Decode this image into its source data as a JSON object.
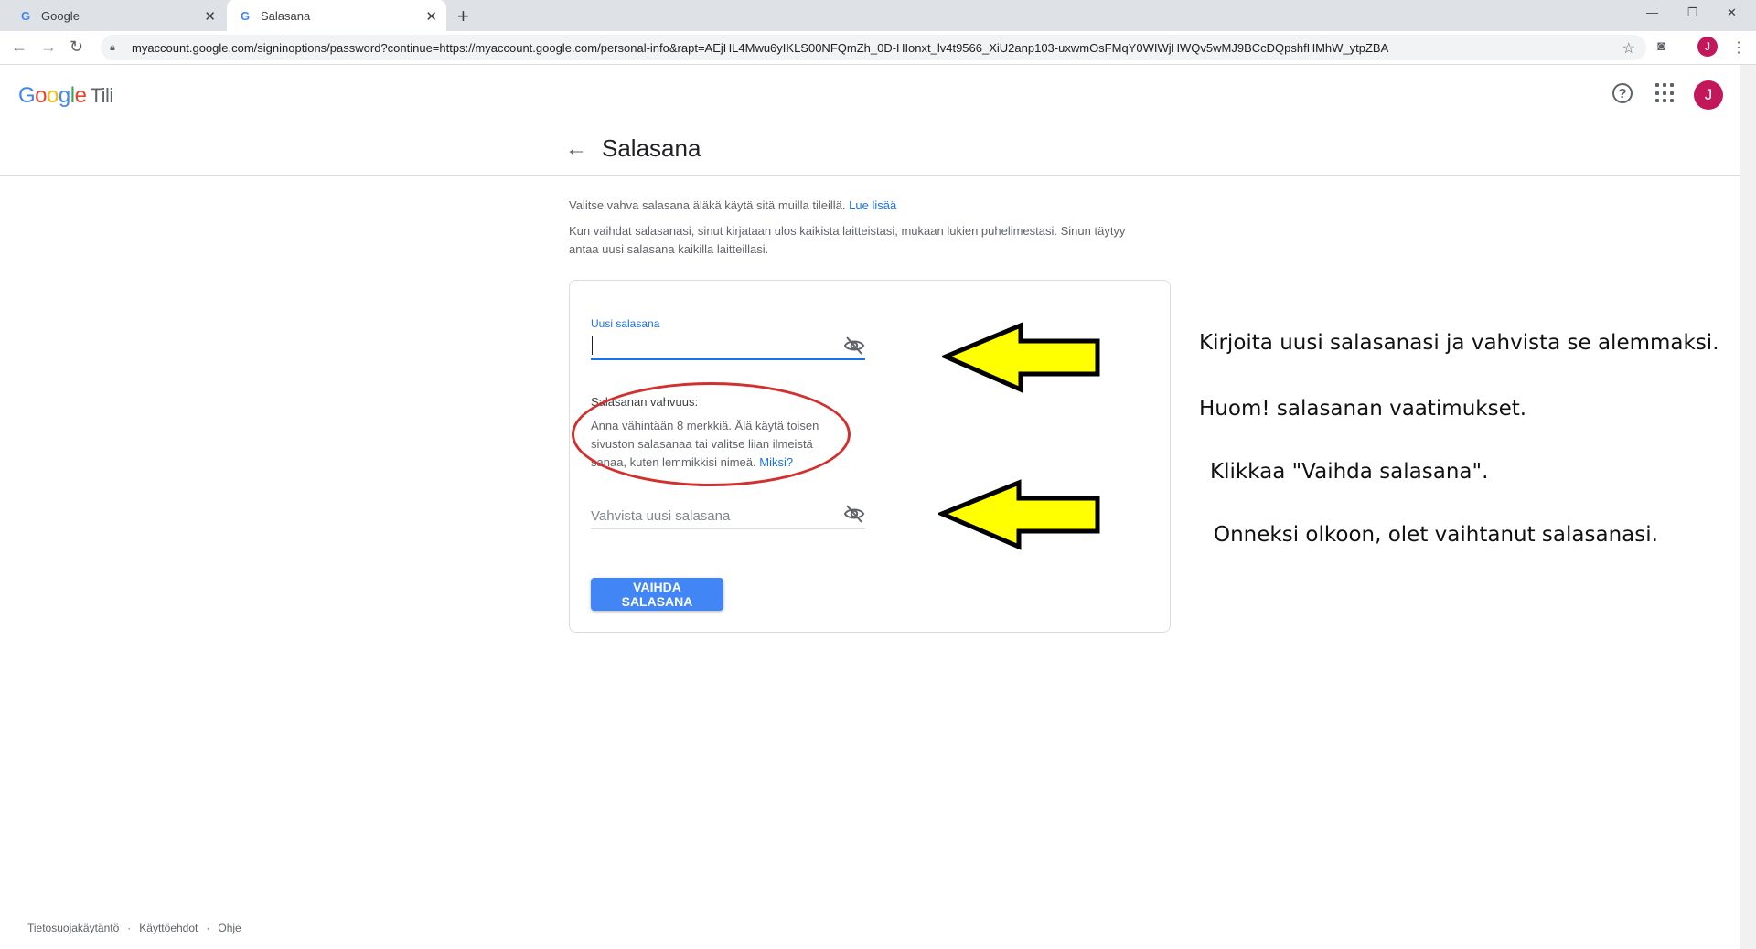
{
  "browser": {
    "tabs": [
      {
        "title": "Google",
        "active": false
      },
      {
        "title": "Salasana",
        "active": true
      }
    ],
    "url": "myaccount.google.com/signinoptions/password?continue=https://myaccount.google.com/personal-info&rapt=AEjHL4Mwu6yIKLS00NFQmZh_0D-HIonxt_lv4t9566_XiU2anp103-uxwmOsFMqY0WIWjHWQv5wMJ9BCcDQpshfHMhW_ytpZBA",
    "profile_initial": "J"
  },
  "header": {
    "logo_text": "Google",
    "product": "Tili",
    "avatar_initial": "J",
    "page_title": "Salasana"
  },
  "intro": {
    "line1": "Valitse vahva salasana äläkä käytä sitä muilla tileillä.",
    "line1_link": "Lue lisää",
    "line2": "Kun vaihdat salasanasi, sinut kirjataan ulos kaikista laitteistasi, mukaan lukien puhelimestasi. Sinun täytyy antaa uusi salasana kaikilla laitteillasi."
  },
  "form": {
    "new_password_label": "Uusi salasana",
    "new_password_value": "",
    "strength_title": "Salasanan vahvuus:",
    "strength_text": "Anna vähintään 8 merkkiä. Älä käytä toisen sivuston salasanaa tai valitse liian ilmeistä sanaa, kuten lemmikkisi nimeä.",
    "strength_link": "Miksi?",
    "confirm_placeholder": "Vahvista uusi salasana",
    "submit_label": "VAIHDA SALASANA"
  },
  "annotations": {
    "note1": "Kirjoita uusi salasanasi ja vahvista se alemmaksi.",
    "note2": "Huom! salasanan vaatimukset.",
    "note3": "Klikkaa \"Vaihda salasana\".",
    "note4": "Onneksi olkoon, olet vaihtanut salasanasi."
  },
  "footer": {
    "privacy": "Tietosuojakäytäntö",
    "terms": "Käyttöehdot",
    "help": "Ohje"
  },
  "colors": {
    "accent": "#1a73e8",
    "button": "#4285f4",
    "annotation_arrow": "#ffff00",
    "annotation_ellipse": "#d32f2f"
  }
}
